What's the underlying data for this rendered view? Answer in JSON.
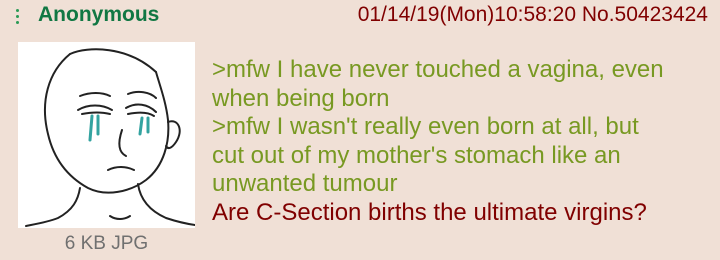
{
  "post": {
    "name": "Anonymous",
    "datetime": "01/14/19(Mon)10:58:20",
    "post_number": "No.50423424",
    "file": {
      "info": "6 KB JPG",
      "thumbnail_icon": "crying-wojak-image"
    },
    "message": {
      "lines": [
        {
          "type": "greentext",
          "text": ">mfw I have never touched a vagina, even"
        },
        {
          "type": "greentext",
          "text": "when being born"
        },
        {
          "type": "greentext",
          "text": ">mfw I wasn't really even born at all, but"
        },
        {
          "type": "greentext",
          "text": "cut out of my mother's stomach like an"
        },
        {
          "type": "greentext",
          "text": "unwanted tumour"
        },
        {
          "type": "plain",
          "text": "Are C-Section births the ultimate virgins?"
        }
      ]
    }
  },
  "colors": {
    "background": "#f0e0d6",
    "name": "#117743",
    "text": "#800000",
    "greentext": "#789922",
    "file_info": "#707070",
    "menu_dots": "#2a9a55"
  }
}
